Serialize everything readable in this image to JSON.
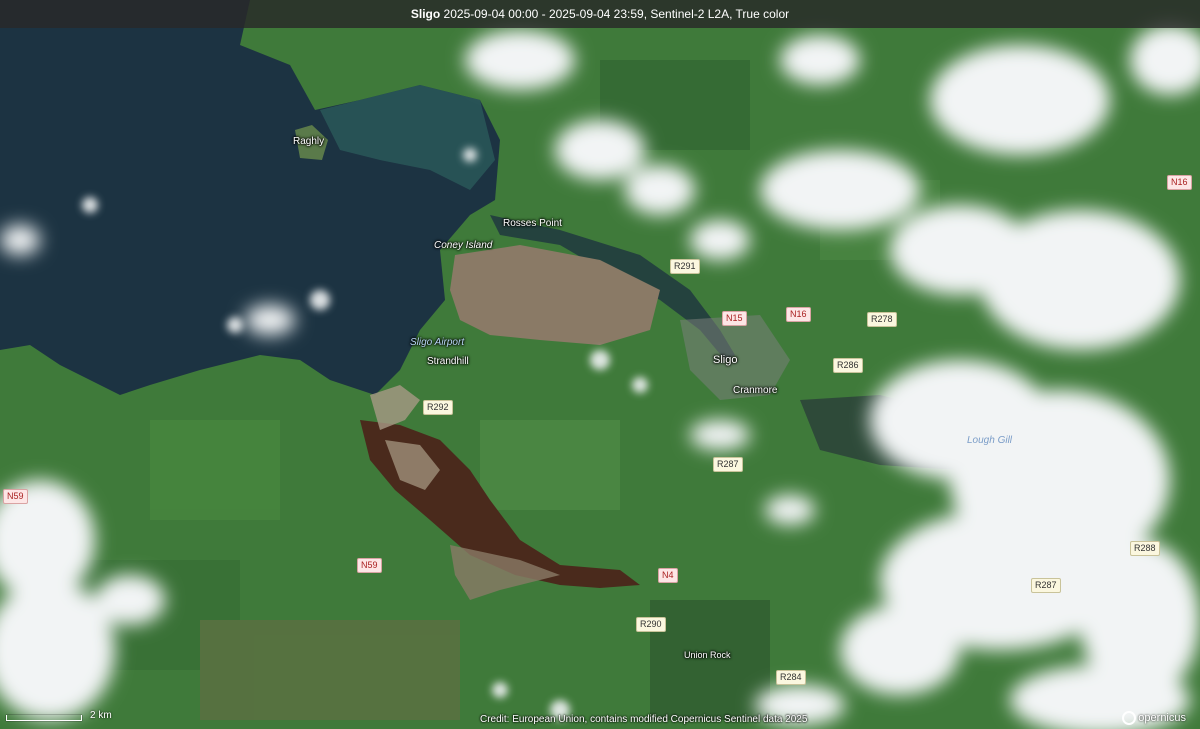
{
  "header": {
    "place": "Sligo",
    "details": "2025-09-04 00:00 - 2025-09-04 23:59, Sentinel-2 L2A, True color"
  },
  "places": {
    "raghly": "Raghly",
    "rosses_point": "Rosses Point",
    "coney_island": "Coney Island",
    "sligo_airport": "Sligo Airport",
    "strandhill": "Strandhill",
    "sligo": "Sligo",
    "cranmore": "Cranmore",
    "lough_gill": "Lough Gill",
    "union_rock": "Union Rock"
  },
  "roads": {
    "n16_east": "N16",
    "r291": "R291",
    "n15": "N15",
    "n16": "N16",
    "r278": "R278",
    "r286": "R286",
    "r292": "R292",
    "r287_west": "R287",
    "n59_west": "N59",
    "n59": "N59",
    "n4": "N4",
    "r290": "R290",
    "r288": "R288",
    "r287_east": "R287",
    "r284": "R284"
  },
  "scale": {
    "label": "2 km"
  },
  "credit": "Credit: European Union, contains modified Copernicus Sentinel data 2025",
  "logo": "opernicus",
  "colors": {
    "sea": "#1c3342",
    "land": "#3f7a3a",
    "tidal_flat": "#8a7a66",
    "estuary_mud": "#4a2a1c",
    "cloud": "#f2f4f5"
  }
}
